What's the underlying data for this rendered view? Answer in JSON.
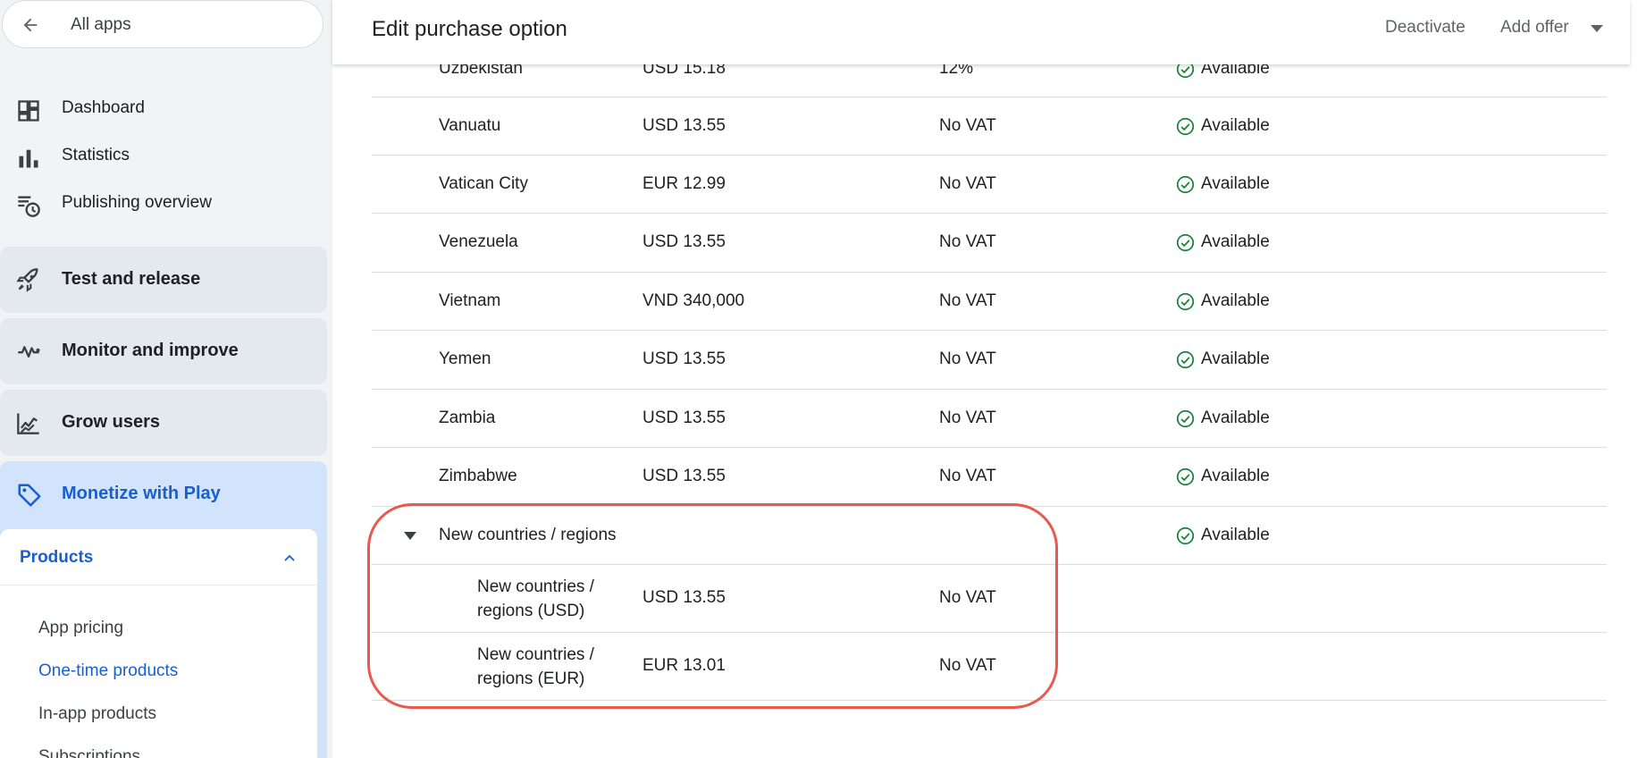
{
  "sidebar": {
    "all_apps": "All apps",
    "nav": [
      {
        "label": "Dashboard",
        "icon": "dashboard-icon"
      },
      {
        "label": "Statistics",
        "icon": "bar-chart-icon"
      },
      {
        "label": "Publishing overview",
        "icon": "schedule-list-icon"
      }
    ],
    "sections": [
      {
        "label": "Test and release",
        "icon": "rocket-icon"
      },
      {
        "label": "Monitor and improve",
        "icon": "pulse-icon"
      },
      {
        "label": "Grow users",
        "icon": "growth-chart-icon"
      }
    ],
    "monetize": {
      "label": "Monetize with Play",
      "icon": "tag-icon"
    },
    "products": {
      "label": "Products",
      "items": [
        {
          "label": "App pricing"
        },
        {
          "label": "One-time products"
        },
        {
          "label": "In-app products"
        },
        {
          "label": "Subscriptions"
        }
      ]
    }
  },
  "header": {
    "title": "Edit purchase option",
    "deactivate": "Deactivate",
    "add_offer": "Add offer"
  },
  "table": {
    "rows": [
      {
        "country": "Uzbekistan",
        "price": "USD 15.18",
        "tax": "12%",
        "status": "Available"
      },
      {
        "country": "Vanuatu",
        "price": "USD 13.55",
        "tax": "No VAT",
        "status": "Available"
      },
      {
        "country": "Vatican City",
        "price": "EUR 12.99",
        "tax": "No VAT",
        "status": "Available"
      },
      {
        "country": "Venezuela",
        "price": "USD 13.55",
        "tax": "No VAT",
        "status": "Available"
      },
      {
        "country": "Vietnam",
        "price": "VND 340,000",
        "tax": "No VAT",
        "status": "Available"
      },
      {
        "country": "Yemen",
        "price": "USD 13.55",
        "tax": "No VAT",
        "status": "Available"
      },
      {
        "country": "Zambia",
        "price": "USD 13.55",
        "tax": "No VAT",
        "status": "Available"
      },
      {
        "country": "Zimbabwe",
        "price": "USD 13.55",
        "tax": "No VAT",
        "status": "Available"
      }
    ],
    "group": {
      "label": "New countries / regions",
      "status": "Available",
      "children": [
        {
          "line1": "New countries /",
          "line2": "regions (USD)",
          "price": "USD 13.55",
          "tax": "No VAT"
        },
        {
          "line1": "New countries /",
          "line2": "regions (EUR)",
          "price": "EUR 13.01",
          "tax": "No VAT"
        }
      ]
    }
  },
  "colors": {
    "accent": "#1a5fd0",
    "available_green": "#188038",
    "highlight": "#e8594e"
  }
}
